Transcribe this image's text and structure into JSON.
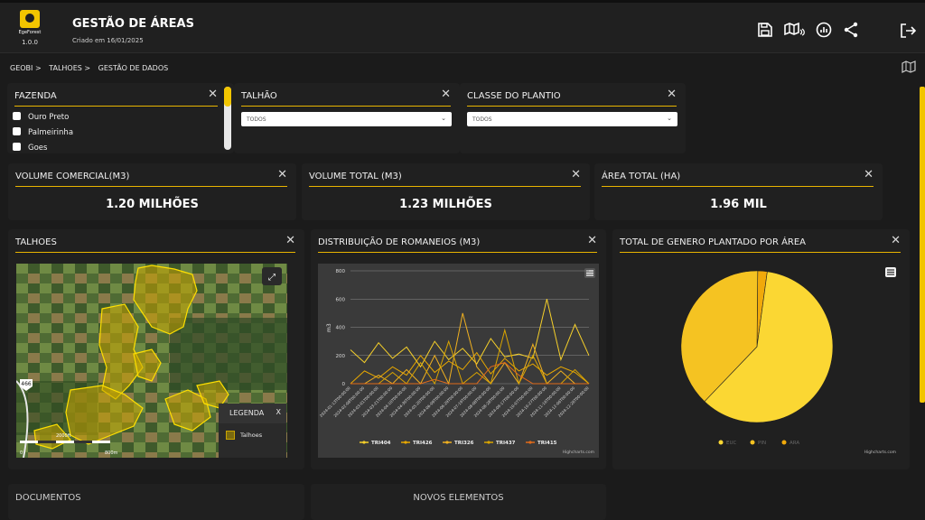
{
  "app": {
    "brand": "EgeForest",
    "version": "1.0.0",
    "title": "GESTÃO DE ÁREAS",
    "subtitle": "Criado em 16/01/2025"
  },
  "toolbar": {
    "icons": [
      "save-icon",
      "map-share-icon",
      "report-icon",
      "share-icon",
      "logout-icon"
    ]
  },
  "breadcrumb": [
    "GEOBI >",
    "TALHOES >",
    "GESTÃO DE DADOS"
  ],
  "filters": {
    "fazenda": {
      "title": "FAZENDA",
      "options": [
        "Ouro Preto",
        "Palmeirinha",
        "Goes"
      ]
    },
    "talhao": {
      "title": "TALHÃO",
      "value": "TODOS"
    },
    "classe": {
      "title": "CLASSE DO PLANTIO",
      "value": "TODOS"
    }
  },
  "kpis": [
    {
      "title": "VOLUME COMERCIAL(M3)",
      "value": "1.20 MILHÕES"
    },
    {
      "title": "VOLUME TOTAL (M3)",
      "value": "1.23 MILHÕES"
    },
    {
      "title": "ÁREA TOTAL (HA)",
      "value": "1.96 MIL"
    }
  ],
  "map": {
    "title": "TALHOES",
    "legend_title": "LEGENDA",
    "legend_close": "X",
    "legend_item": "Talhoes",
    "road": "466",
    "scale": [
      "0",
      "2000ft",
      "800m"
    ]
  },
  "colors": {
    "accent": "#f2c500",
    "background": "#1b1b1b",
    "card": "#202020"
  },
  "chart_data": [
    {
      "type": "line",
      "title": "DISTRIBUIÇÃO DE ROMANEIOS (M3)",
      "ylabel": "m3",
      "ylim": [
        0,
        800
      ],
      "yticks": [
        0,
        200,
        400,
        600,
        800
      ],
      "x": [
        "2024-01-13T00:00:00",
        "2024-02-08T00:00:00",
        "2024-03-01T00:00:00",
        "2024-03-21T00:00:00",
        "2024-04-10T00:00:00",
        "2024-04-30T00:00:00",
        "2024-05-20T00:00:00",
        "2024-06-09T00:00:00",
        "2024-06-29T00:00:00",
        "2024-07-19T00:00:00",
        "2024-08-08T00:00:00",
        "2024-08-28T00:00:00",
        "2024-09-17T00:00:00",
        "2024-10-07T00:00:00",
        "2024-10-27T00:00:00",
        "2024-11-16T00:00:00",
        "2024-12-06T00:00:00",
        "2024-12-26T00:00:00"
      ],
      "series": [
        {
          "name": "TRI404",
          "color": "#f5cf2a",
          "values": [
            240,
            150,
            290,
            180,
            260,
            120,
            300,
            170,
            250,
            140,
            320,
            190,
            210,
            180,
            600,
            170,
            420,
            200
          ]
        },
        {
          "name": "TRI426",
          "color": "#e8a800",
          "values": [
            0,
            90,
            40,
            120,
            60,
            200,
            80,
            160,
            100,
            220,
            70,
            180,
            90,
            140,
            60,
            120,
            80,
            0
          ]
        },
        {
          "name": "TRI326",
          "color": "#f0b020",
          "values": [
            0,
            0,
            60,
            0,
            100,
            0,
            200,
            0,
            500,
            120,
            0,
            150,
            0,
            280,
            0,
            90,
            0,
            0
          ]
        },
        {
          "name": "TRI437",
          "color": "#d9a400",
          "values": [
            0,
            0,
            0,
            80,
            0,
            150,
            0,
            300,
            0,
            80,
            0,
            380,
            0,
            200,
            0,
            0,
            100,
            0
          ]
        },
        {
          "name": "TRI415",
          "color": "#e06a1a",
          "values": [
            0,
            0,
            0,
            0,
            0,
            0,
            30,
            0,
            0,
            0,
            120,
            150,
            60,
            0,
            0,
            0,
            0,
            0
          ]
        }
      ],
      "credit": "Highcharts.com"
    },
    {
      "type": "pie",
      "title": "TOTAL DE GENERO PLANTADO POR ÁREA",
      "categories": [
        "EUC",
        "PIN",
        "ARA"
      ],
      "values": [
        60,
        38,
        2
      ],
      "colors": [
        "#fbd733",
        "#f5c322",
        "#f1a90a"
      ],
      "credit": "Highcharts.com"
    }
  ],
  "bottom": {
    "left_title": "DOCUMENTOS",
    "right_title": "NOVOS ELEMENTOS"
  }
}
